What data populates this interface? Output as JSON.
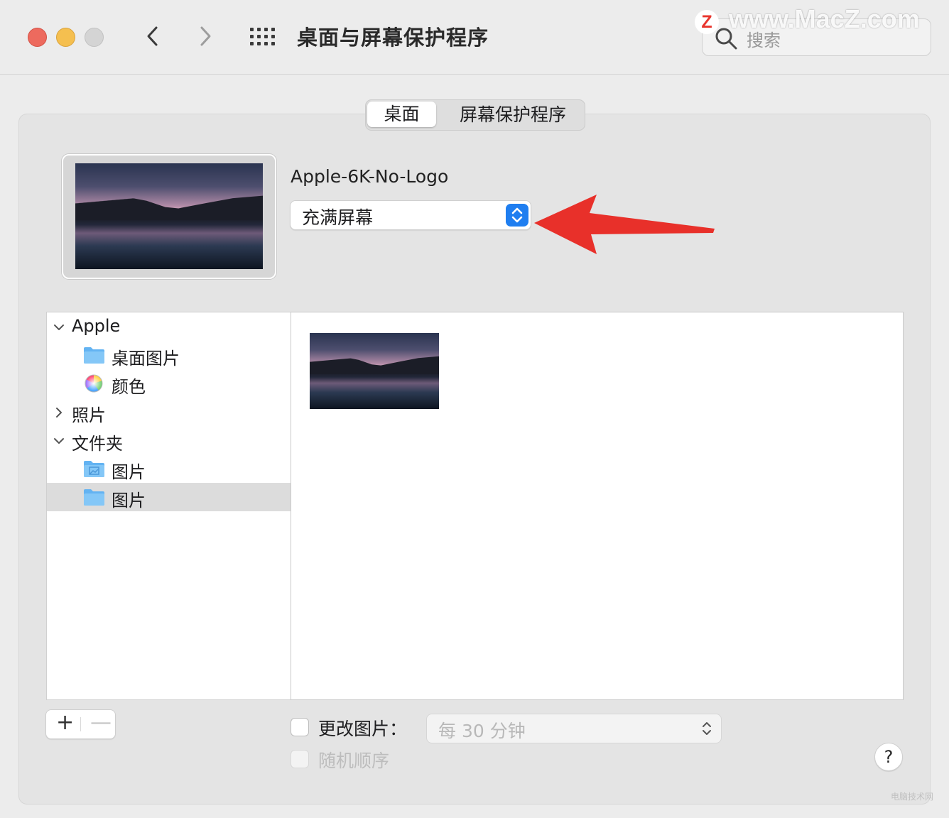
{
  "window": {
    "title": "桌面与屏幕保护程序",
    "search_placeholder": "搜索",
    "watermark": "www.MacZ.com",
    "watermark_badge": "Z",
    "corner_watermark": "电脑技术网"
  },
  "tabs": [
    {
      "label": "桌面",
      "selected": true
    },
    {
      "label": "屏幕保护程序",
      "selected": false
    }
  ],
  "current": {
    "wallpaper_name": "Apple-6K-No-Logo",
    "fit_mode": "充满屏幕"
  },
  "sources": {
    "apple_group": "Apple",
    "desktop_pictures": "桌面图片",
    "colors": "颜色",
    "photos_group": "照片",
    "folders_group": "文件夹",
    "folder_pictures_1": "图片",
    "folder_pictures_2": "图片"
  },
  "controls": {
    "add": "+",
    "remove": "—",
    "change_picture_label": "更改图片：",
    "change_interval": "每 30 分钟",
    "random_order_label": "随机顺序",
    "help": "?"
  },
  "colors": {
    "accent": "#1f7ef0",
    "close": "#ed6a5e",
    "minimize": "#f5bf4f",
    "annotation_arrow": "#e8302a"
  }
}
